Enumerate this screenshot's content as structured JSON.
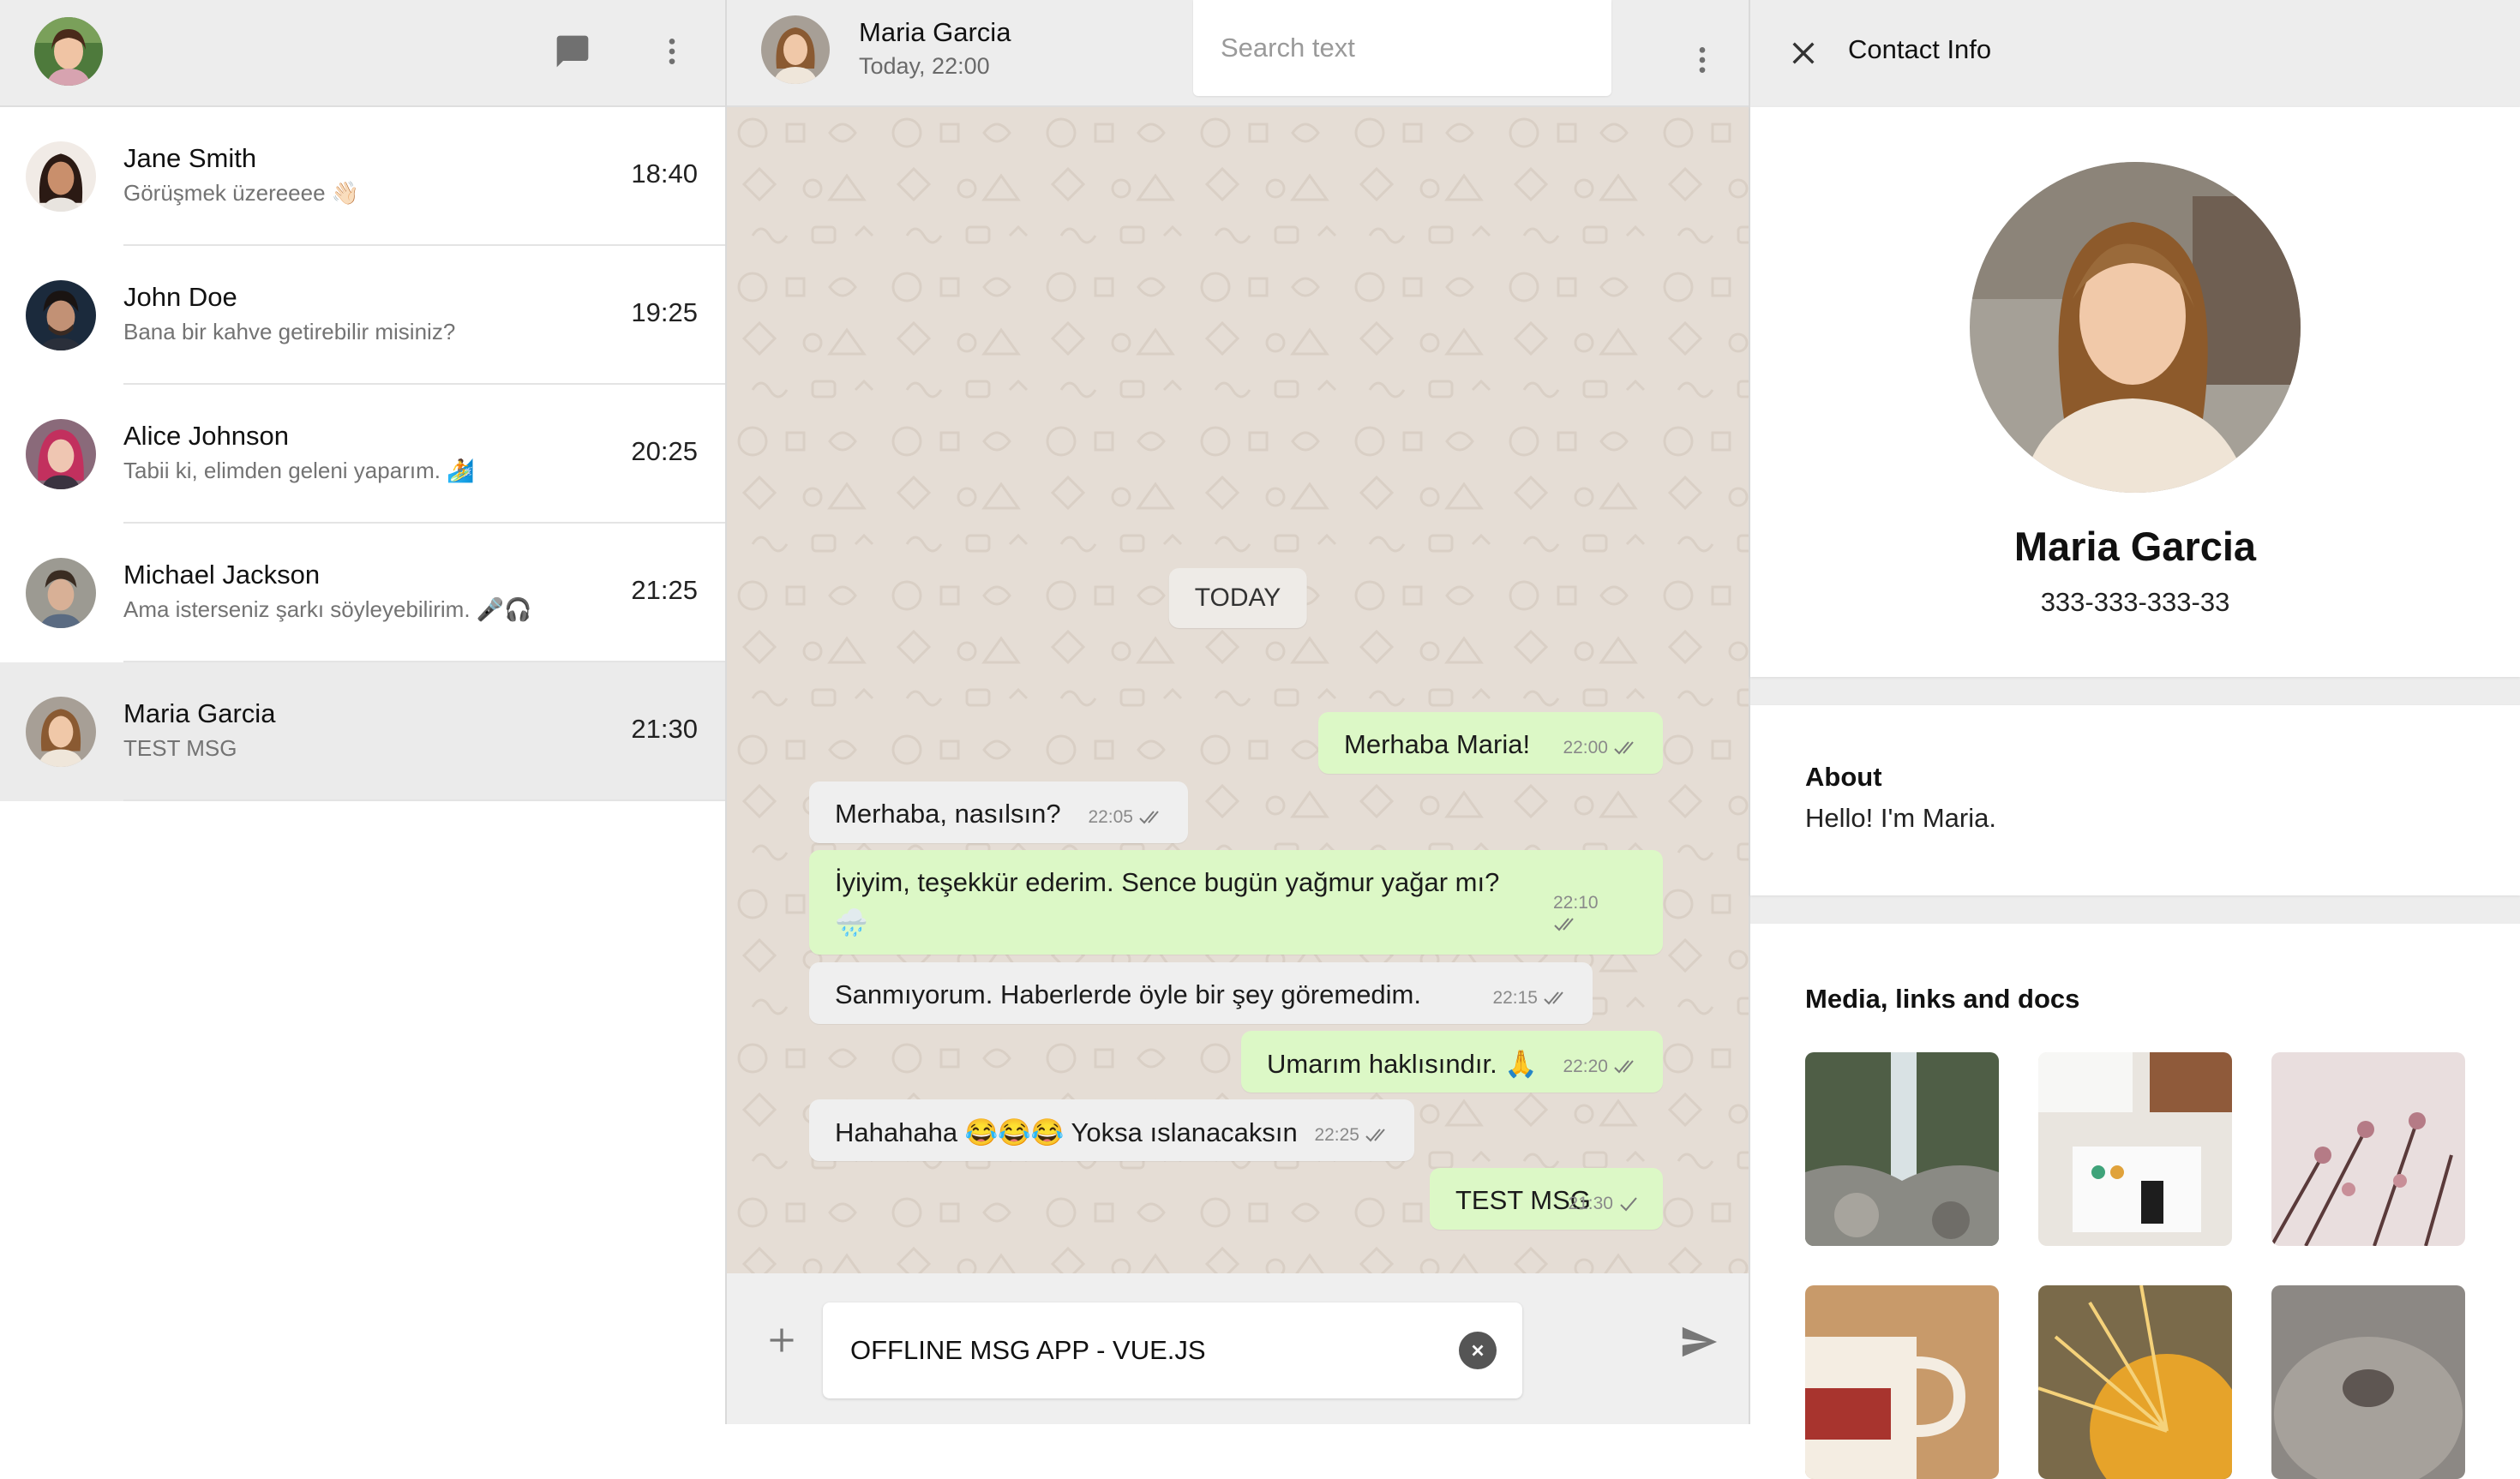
{
  "sidebar": {
    "chats": [
      {
        "name": "Jane Smith",
        "preview": "Görüşmek üzereeee 👋🏻",
        "time": "18:40",
        "active": false
      },
      {
        "name": "John Doe",
        "preview": "Bana bir kahve getirebilir misiniz?",
        "time": "19:25",
        "active": false
      },
      {
        "name": "Alice Johnson",
        "preview": "Tabii ki, elimden geleni yaparım. 🏄",
        "time": "20:25",
        "active": false
      },
      {
        "name": "Michael Jackson",
        "preview": "Ama isterseniz şarkı söyleyebilirim. 🎤🎧",
        "time": "21:25",
        "active": false
      },
      {
        "name": "Maria Garcia",
        "preview": "TEST MSG",
        "time": "21:30",
        "active": true
      }
    ]
  },
  "chat": {
    "contact_name": "Maria Garcia",
    "contact_status": "Today, 22:00",
    "search_placeholder": "Search text",
    "day_label": "TODAY",
    "messages": [
      {
        "dir": "out",
        "text": "Merhaba Maria!",
        "time": "22:00"
      },
      {
        "dir": "in",
        "text": "Merhaba, nasılsın?",
        "time": "22:05"
      },
      {
        "dir": "out",
        "text": "İyiyim, teşekkür ederim. Sence bugün yağmur yağar mı?",
        "text2": "🌧️",
        "time": "22:10"
      },
      {
        "dir": "in",
        "text": "Sanmıyorum. Haberlerde öyle bir şey göremedim.",
        "time": "22:15"
      },
      {
        "dir": "out",
        "text": "Umarım haklısındır. 🙏",
        "time": "22:20"
      },
      {
        "dir": "in",
        "text": "Hahahaha 😂😂😂 Yoksa ıslanacaksın",
        "time": "22:25"
      },
      {
        "dir": "out",
        "text": "TEST MSG",
        "time": "21:30"
      }
    ],
    "composer_value": "OFFLINE MSG APP - VUE.JS"
  },
  "info": {
    "title": "Contact Info",
    "name": "Maria Garcia",
    "phone": "333-333-333-33",
    "about_label": "About",
    "about_text": "Hello! I'm Maria.",
    "media_label": "Media, links and docs",
    "media": [
      "waterfall",
      "desk",
      "blossom",
      "mug",
      "sunflower",
      "cat"
    ]
  },
  "icons": {
    "new_chat": "message-icon",
    "menu": "more-vertical-icon",
    "close": "close-icon",
    "attach": "plus-icon",
    "clear": "clear-icon",
    "send": "send-icon",
    "read": "double-check-icon"
  }
}
